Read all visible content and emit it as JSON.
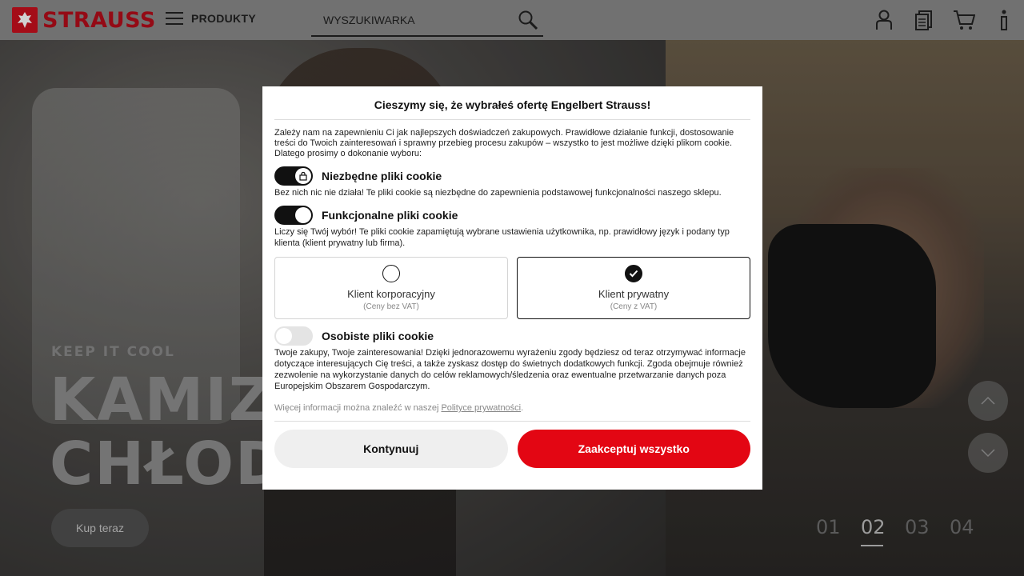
{
  "header": {
    "brand": "STRAUSS",
    "menu_label": "PRODUKTY",
    "search_placeholder": "WYSZUKIWARKA",
    "icons": [
      "user-icon",
      "catalog-icon",
      "cart-icon",
      "info-icon"
    ]
  },
  "hero": {
    "overline": "KEEP IT COOL",
    "headline_line1": "KAMIZ",
    "headline_line2": "CHŁOD",
    "cta_label": "Kup teraz",
    "pager": [
      "01",
      "02",
      "03",
      "04"
    ],
    "pager_active": "02"
  },
  "consent": {
    "title": "Cieszymy się, że wybrałeś ofertę Engelbert Strauss!",
    "intro": "Zależy nam na zapewnieniu Ci jak najlepszych doświadczeń zakupowych. Prawidłowe działanie funkcji, dostosowanie treści do Twoich zainteresowań i sprawny przebieg procesu zakupów – wszystko to jest możliwe dzięki plikom cookie. Dlatego prosimy o dokonanie wyboru:",
    "necessary": {
      "title": "Niezbędne pliki cookie",
      "desc": "Bez nich nic nie działa! Te pliki cookie są niezbędne do zapewnienia podstawowej funkcjonalności naszego sklepu.",
      "enabled": true,
      "locked": true
    },
    "functional": {
      "title": "Funkcjonalne pliki cookie",
      "desc": "Liczy się Twój wybór! Te pliki cookie zapamiętują wybrane ustawienia użytkownika, np. prawidłowy język i podany typ klienta (klient prywatny lub firma).",
      "enabled": true
    },
    "customer_types": [
      {
        "label": "Klient korporacyjny",
        "sub": "(Ceny bez VAT)",
        "selected": false
      },
      {
        "label": "Klient prywatny",
        "sub": "(Ceny z VAT)",
        "selected": true
      }
    ],
    "personal": {
      "title": "Osobiste pliki cookie",
      "desc": "Twoje zakupy, Twoje zainteresowania! Dzięki jednorazowemu wyrażeniu zgody będziesz od teraz otrzymywać informacje dotyczące interesujących Cię treści, a także zyskasz dostęp do świetnych dodatkowych funkcji. Zgoda obejmuje również zezwolenie na wykorzystanie danych do celów reklamowych/śledzenia oraz ewentualne przetwarzanie danych poza Europejskim Obszarem Gospodarczym.",
      "enabled": false
    },
    "more_info_prefix": "Więcej informacji można znaleźć w naszej ",
    "more_info_link": "Polityce prywatności",
    "more_info_suffix": ".",
    "continue_label": "Kontynuuj",
    "accept_label": "Zaakceptuj wszystko"
  },
  "colors": {
    "brand_red": "#c8101e",
    "accept_red": "#e30613"
  }
}
